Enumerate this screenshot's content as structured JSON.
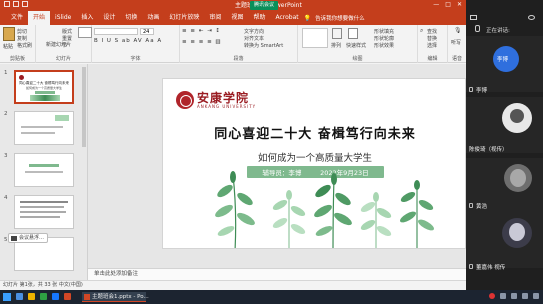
{
  "window": {
    "title": "主题班会1 - PowerPoint",
    "rec_badge": "腾讯会议",
    "controls": [
      "—",
      "□",
      "✕"
    ]
  },
  "ribbon_tabs": [
    "文件",
    "开始",
    "iSlide",
    "插入",
    "设计",
    "切换",
    "动画",
    "幻灯片放映",
    "审阅",
    "视图",
    "帮助",
    "Acrobat"
  ],
  "active_tab": "开始",
  "tell_me": "告诉我你想要做什么",
  "ribbon": {
    "clipboard": {
      "label": "剪贴板",
      "paste": "粘贴",
      "cut": "剪切",
      "copy": "复制",
      "format": "格式刷"
    },
    "slides": {
      "label": "幻灯片",
      "new_slide": "新建幻灯片",
      "layout": "版式",
      "reset": "重置",
      "section": "节"
    },
    "font": {
      "label": "字体",
      "size": "24"
    },
    "paragraph": {
      "label": "段落",
      "text_direction": "文字方向",
      "align_text": "对齐文本",
      "smartart": "转换为 SmartArt"
    },
    "drawing": {
      "label": "绘图",
      "arrange": "排列",
      "quick_styles": "快速样式",
      "shape_fill": "形状填充",
      "shape_outline": "形状轮廓",
      "shape_effects": "形状效果"
    },
    "editing": {
      "label": "编辑",
      "find": "查找",
      "replace": "替换",
      "select": "选择"
    },
    "voice": {
      "label": "语音",
      "dictate": "听写"
    }
  },
  "thumbnails": [
    {
      "num": "1"
    },
    {
      "num": "2"
    },
    {
      "num": "3"
    },
    {
      "num": "4"
    },
    {
      "num": "5"
    }
  ],
  "thumb1_text": [
    "同心喜迎二十大 奋楫笃行向未来",
    "如何成为一个高质量大学生"
  ],
  "chip_label": "会议悬浮…",
  "slide": {
    "logo_cn": "安康学院",
    "logo_en": "ANKANG UNIVERSITY",
    "title": "同心喜迎二十大  奋楫笃行向未来",
    "subtitle": "如何成为一个高质量大学生",
    "banner_left": "辅导员：李博",
    "banner_right": "2022年9月23日",
    "colors": {
      "brand_red": "#9a1c22",
      "banner_green": "#7fb98e",
      "leaf_dark": "#3e8c55",
      "leaf_light": "#a7d6b1"
    }
  },
  "notes_placeholder": "单击此处添加备注",
  "statusbar": "幻灯片 第1张，共 33 张   中文(中国)",
  "meeting": {
    "speaking_label": "正在讲话:",
    "participants": [
      {
        "name": "李博",
        "avatar_text": "李博",
        "role": ""
      },
      {
        "name": "陈俊琦（视传）",
        "avatar_text": "",
        "role": ""
      },
      {
        "name": "黄浩",
        "avatar_text": "",
        "role": ""
      },
      {
        "name": "董嘉伟 视传",
        "avatar_text": "",
        "role": ""
      }
    ]
  },
  "taskbar": {
    "app_label": "主题班会1.pptx - Po..."
  }
}
